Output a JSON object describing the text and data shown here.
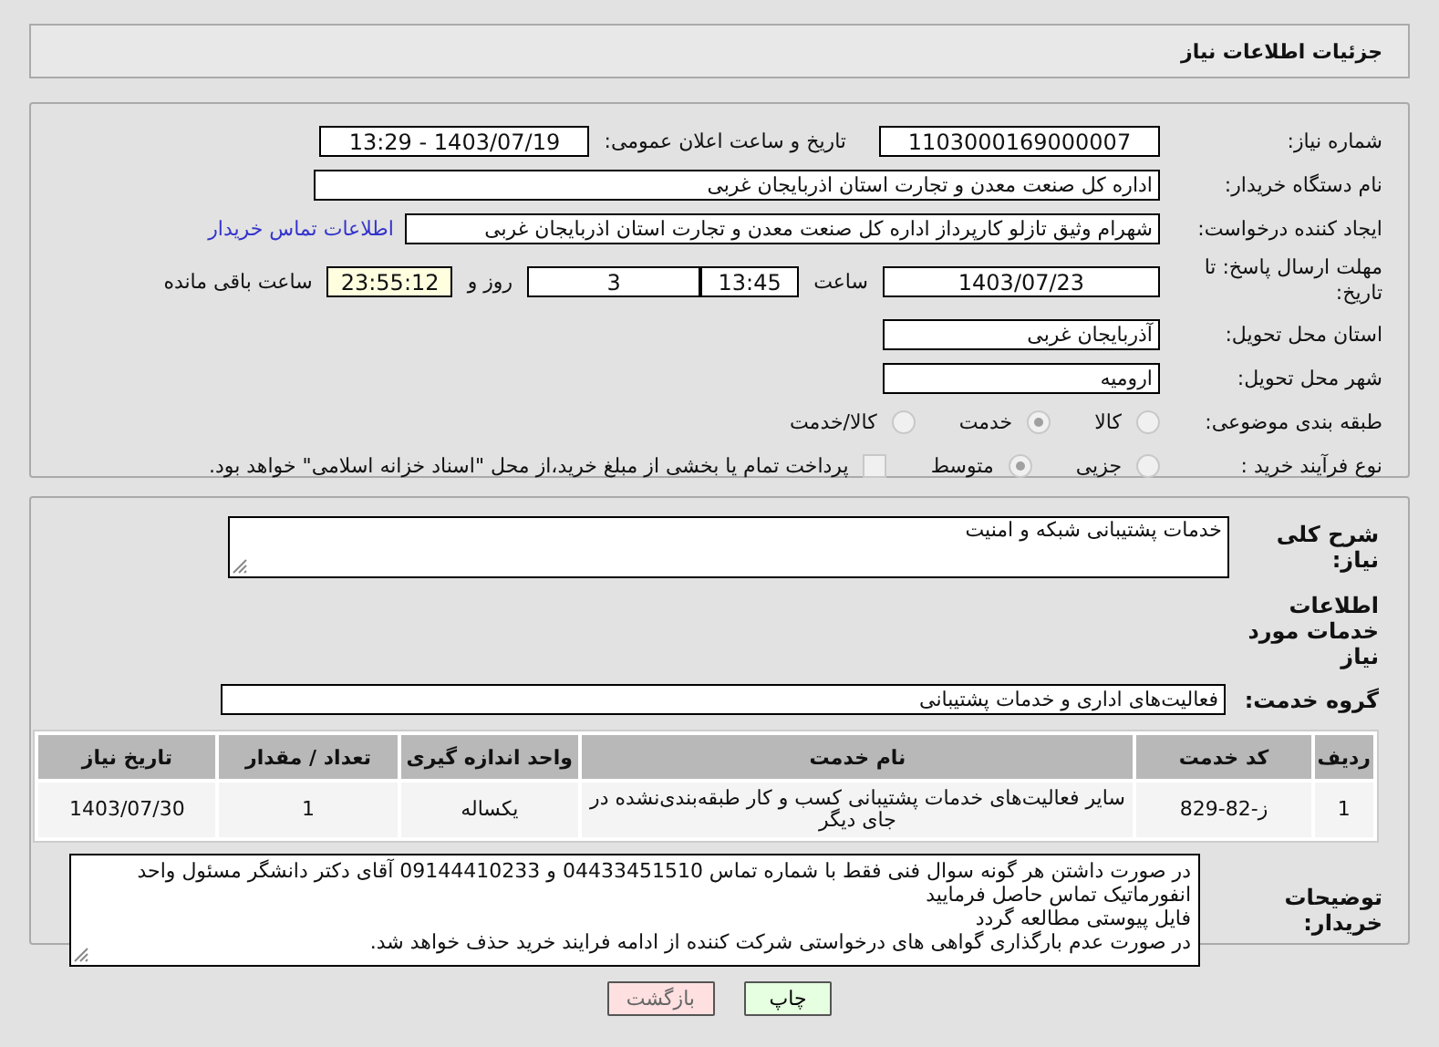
{
  "header": {
    "title": "جزئیات اطلاعات نیاز"
  },
  "need_number": {
    "label": "شماره نیاز:",
    "value": "1103000169000007"
  },
  "announce": {
    "label": "تاریخ و ساعت اعلان عمومی:",
    "value": "1403/07/19 - 13:29"
  },
  "buyer_org": {
    "label": "نام دستگاه خریدار:",
    "value": "اداره کل صنعت  معدن و تجارت استان اذربایجان غربی"
  },
  "requester": {
    "label": "ایجاد کننده درخواست:",
    "value": "شهرام وثیق تازلو کارپرداز اداره کل صنعت  معدن و تجارت استان اذربایجان غربی",
    "link": "اطلاعات تماس خریدار"
  },
  "deadline": {
    "label": "مهلت ارسال پاسخ: تا تاریخ:",
    "date": "1403/07/23",
    "time_label": "ساعت",
    "time": "13:45",
    "days": "3",
    "days_label": "روز و",
    "remaining": "23:55:12",
    "remaining_label": "ساعت باقی مانده"
  },
  "province": {
    "label": "استان محل تحویل:",
    "value": "آذربایجان غربی"
  },
  "city": {
    "label": "شهر محل تحویل:",
    "value": "ارومیه"
  },
  "category": {
    "label": "طبقه بندی موضوعی:",
    "options": [
      {
        "label": "کالا",
        "selected": false
      },
      {
        "label": "خدمت",
        "selected": true
      },
      {
        "label": "کالا/خدمت",
        "selected": false
      }
    ]
  },
  "purchase_type": {
    "label": "نوع فرآیند خرید :",
    "options": [
      {
        "label": "جزیی",
        "selected": false
      },
      {
        "label": "متوسط",
        "selected": true
      }
    ],
    "checkbox": {
      "label": "پرداخت تمام یا بخشی از مبلغ خرید،از محل \"اسناد خزانه اسلامی\" خواهد بود.",
      "checked": false
    }
  },
  "description": {
    "label": "شرح کلی نیاز:",
    "value": "خدمات پشتیبانی شبکه و امنیت"
  },
  "services_heading": "اطلاعات خدمات مورد نیاز",
  "service_group": {
    "label": "گروه خدمت:",
    "value": "فعالیت‌های اداری و خدمات پشتیبانی"
  },
  "table": {
    "columns": [
      "ردیف",
      "کد خدمت",
      "نام خدمت",
      "واحد اندازه گیری",
      "تعداد / مقدار",
      "تاریخ نیاز"
    ],
    "rows": [
      [
        "1",
        "ز-82-829",
        "سایر فعالیت‌های خدمات پشتیبانی کسب و کار طبقه‌بندی‌نشده در جای دیگر",
        "یکساله",
        "1",
        "1403/07/30"
      ]
    ]
  },
  "buyer_notes": {
    "label": "توضیحات خریدار:",
    "value": "در صورت داشتن هر گونه سوال فنی فقط با شماره تماس 04433451510 و 09144410233 آقای دکتر دانشگر مسئول واحد انفورماتیک تماس حاصل فرمایید\nفایل پیوستی مطالعه گردد\nدر صورت عدم بارگذاری گواهی های درخواستی شرکت کننده از ادامه فرایند خرید حذف خواهد شد."
  },
  "buttons": [
    {
      "label": "چاپ",
      "kind": "print"
    },
    {
      "label": "بازگشت",
      "kind": "back"
    }
  ]
}
